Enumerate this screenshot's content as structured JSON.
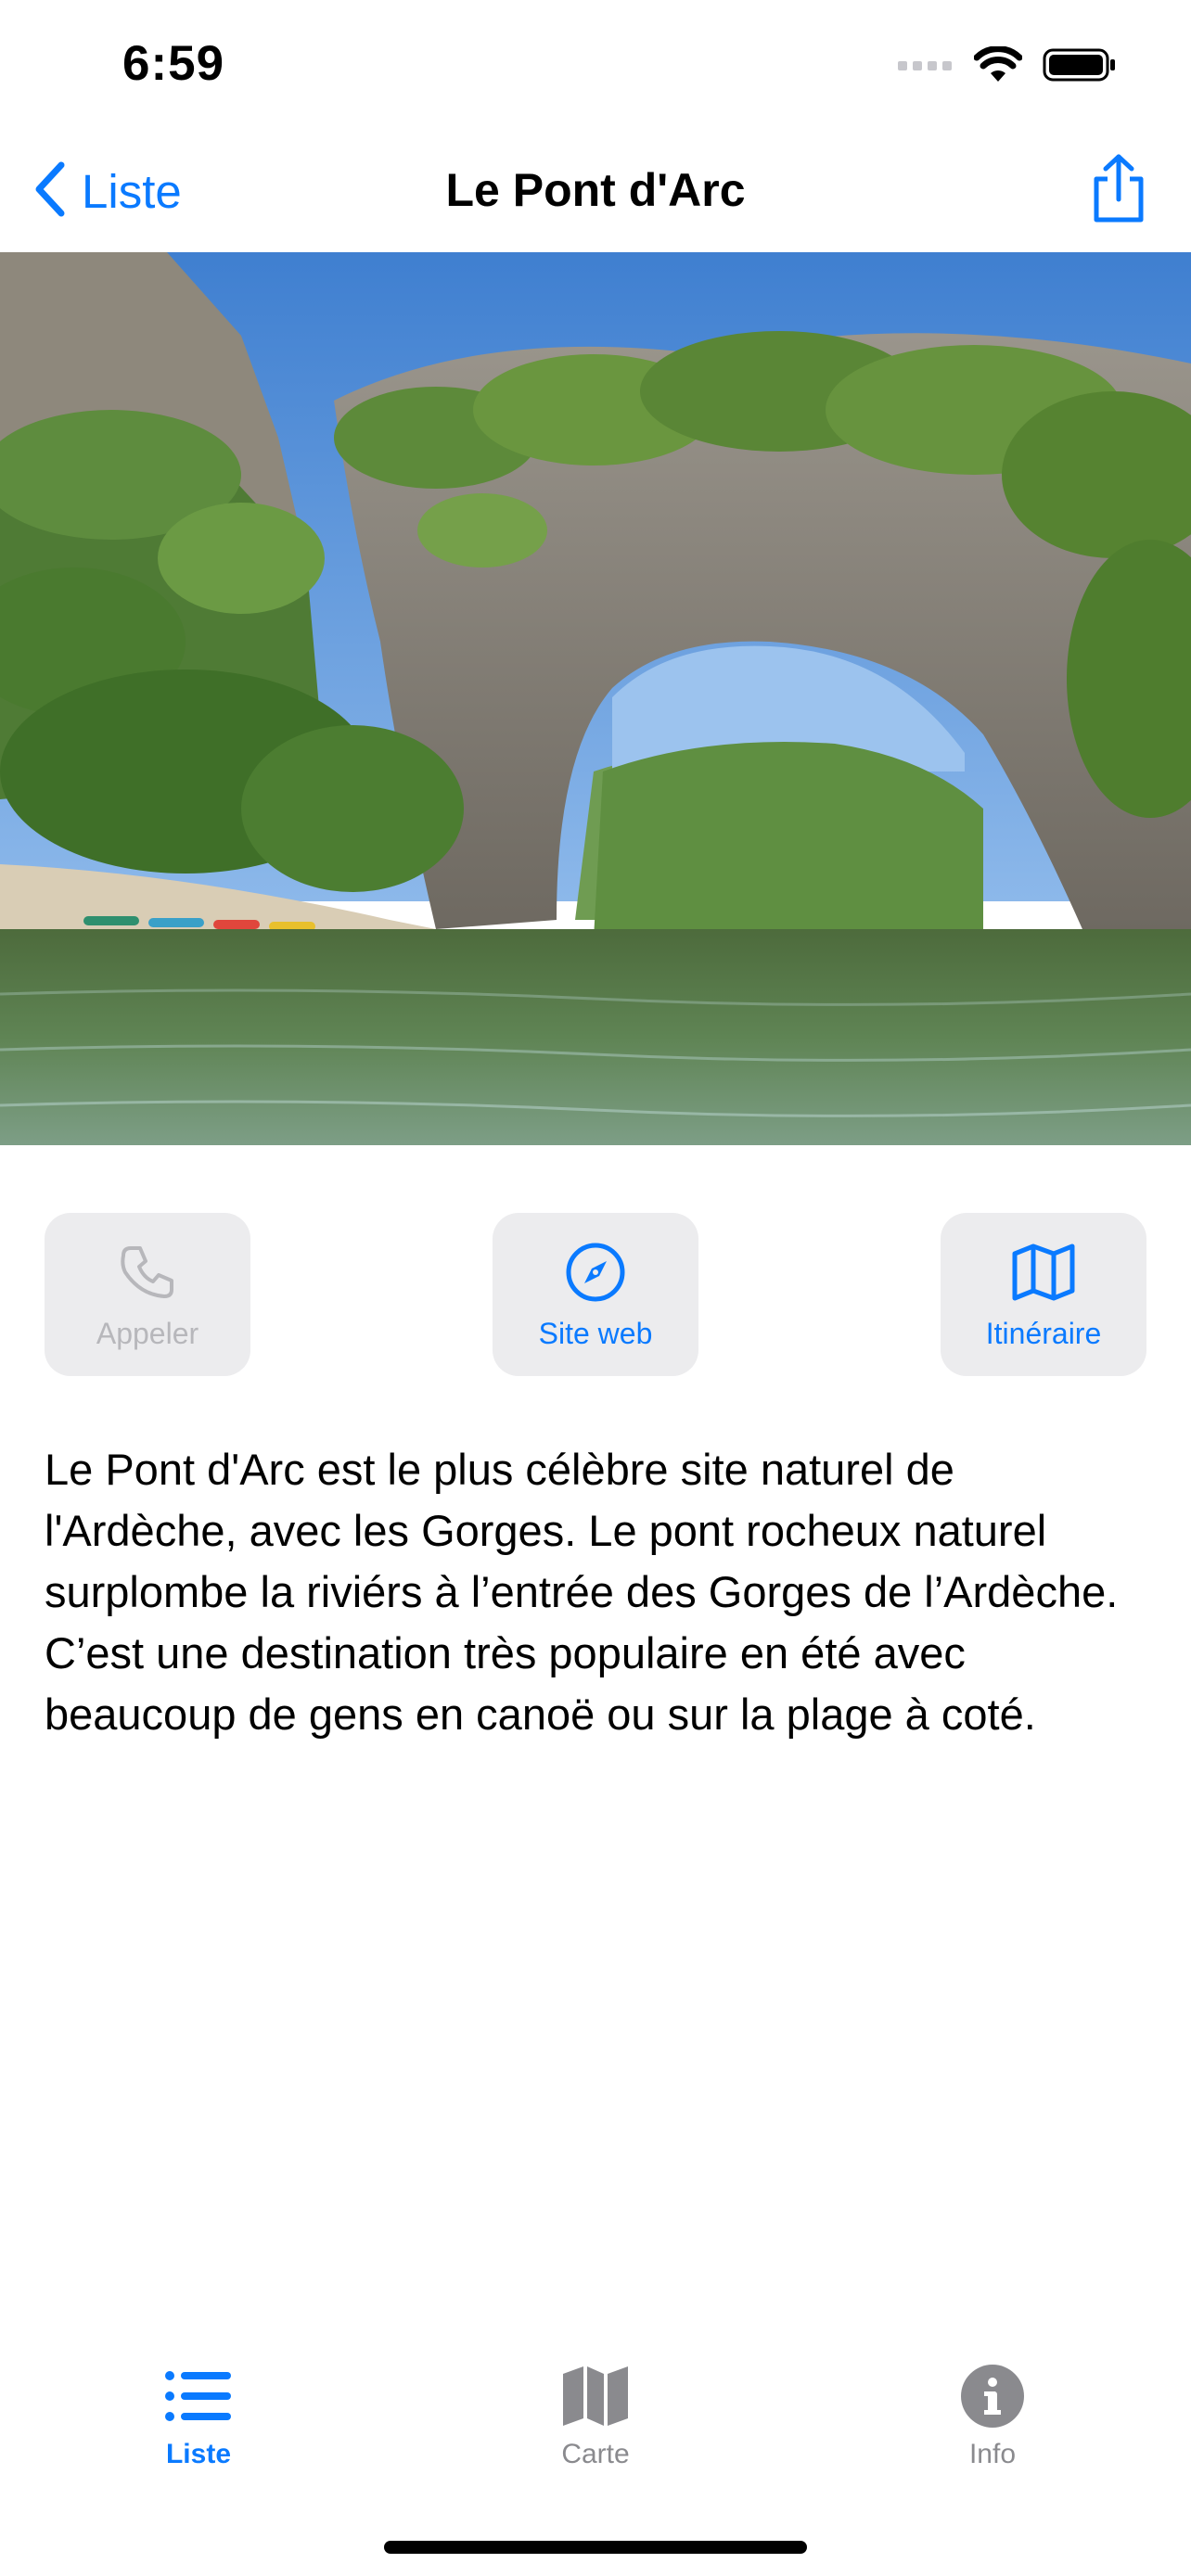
{
  "status_bar": {
    "time": "6:59",
    "icons": [
      "signal-icon",
      "wifi-icon",
      "battery-icon"
    ]
  },
  "nav": {
    "back_label": "Liste",
    "title": "Le Pont d'Arc",
    "share_icon": "share-icon"
  },
  "hero": {
    "description": "photo-arch-over-river"
  },
  "actions": [
    {
      "label": "Appeler",
      "icon": "phone-icon",
      "enabled": false
    },
    {
      "label": "Site web",
      "icon": "compass-icon",
      "enabled": true
    },
    {
      "label": "Itinéraire",
      "icon": "map-icon",
      "enabled": true
    }
  ],
  "description": "Le Pont d'Arc est le plus célèbre site naturel de l'Ardèche, avec les Gorges. Le pont rocheux naturel surplombe la riviérs à l’entrée des Gorges de l’Ardèche. C’est une destination très populaire en été avec beaucoup de gens en canoë ou sur la plage à coté.",
  "tabs": [
    {
      "label": "Liste",
      "icon": "list-icon",
      "active": true
    },
    {
      "label": "Carte",
      "icon": "map-icon",
      "active": false
    },
    {
      "label": "Info",
      "icon": "info-icon",
      "active": false
    }
  ],
  "colors": {
    "accent": "#0a7aff",
    "inactive": "#8a8a8e",
    "disabled": "#b7b7bb",
    "button_bg": "#ececee"
  }
}
